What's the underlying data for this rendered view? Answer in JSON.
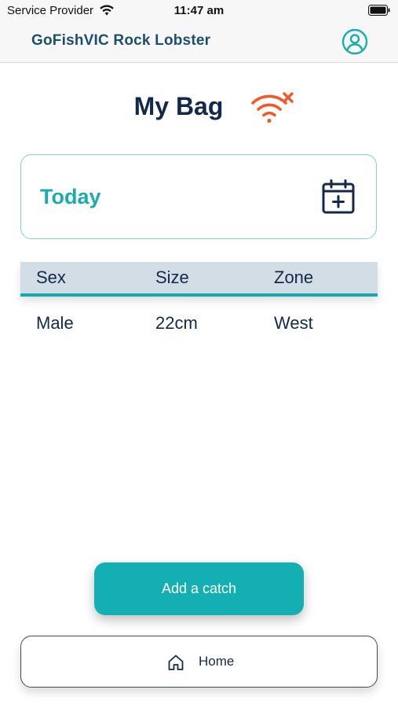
{
  "status_bar": {
    "carrier": "Service Provider",
    "time": "11:47 am",
    "wifi_icon": "wifi-icon",
    "battery_icon": "battery-icon"
  },
  "nav_bar": {
    "title": "GoFishVIC Rock Lobster",
    "profile_icon": "user-circle-icon"
  },
  "page": {
    "heading": "My Bag",
    "connectivity_icon": "wifi-off-icon"
  },
  "date_card": {
    "label": "Today",
    "icon": "calendar-add-icon"
  },
  "catch_table": {
    "columns": [
      "Sex",
      "Size",
      "Zone"
    ],
    "rows": [
      [
        "Male",
        "22cm",
        "West"
      ]
    ]
  },
  "actions": {
    "add_catch_label": "Add a catch"
  },
  "bottom_nav": {
    "home_label": "Home",
    "home_icon": "home-icon"
  },
  "colors": {
    "accent": "#13afb3",
    "navy": "#13294b",
    "title_blue": "#1c4f6e",
    "offline_orange": "#f05a28",
    "table_header_bg": "#d2dde5"
  }
}
